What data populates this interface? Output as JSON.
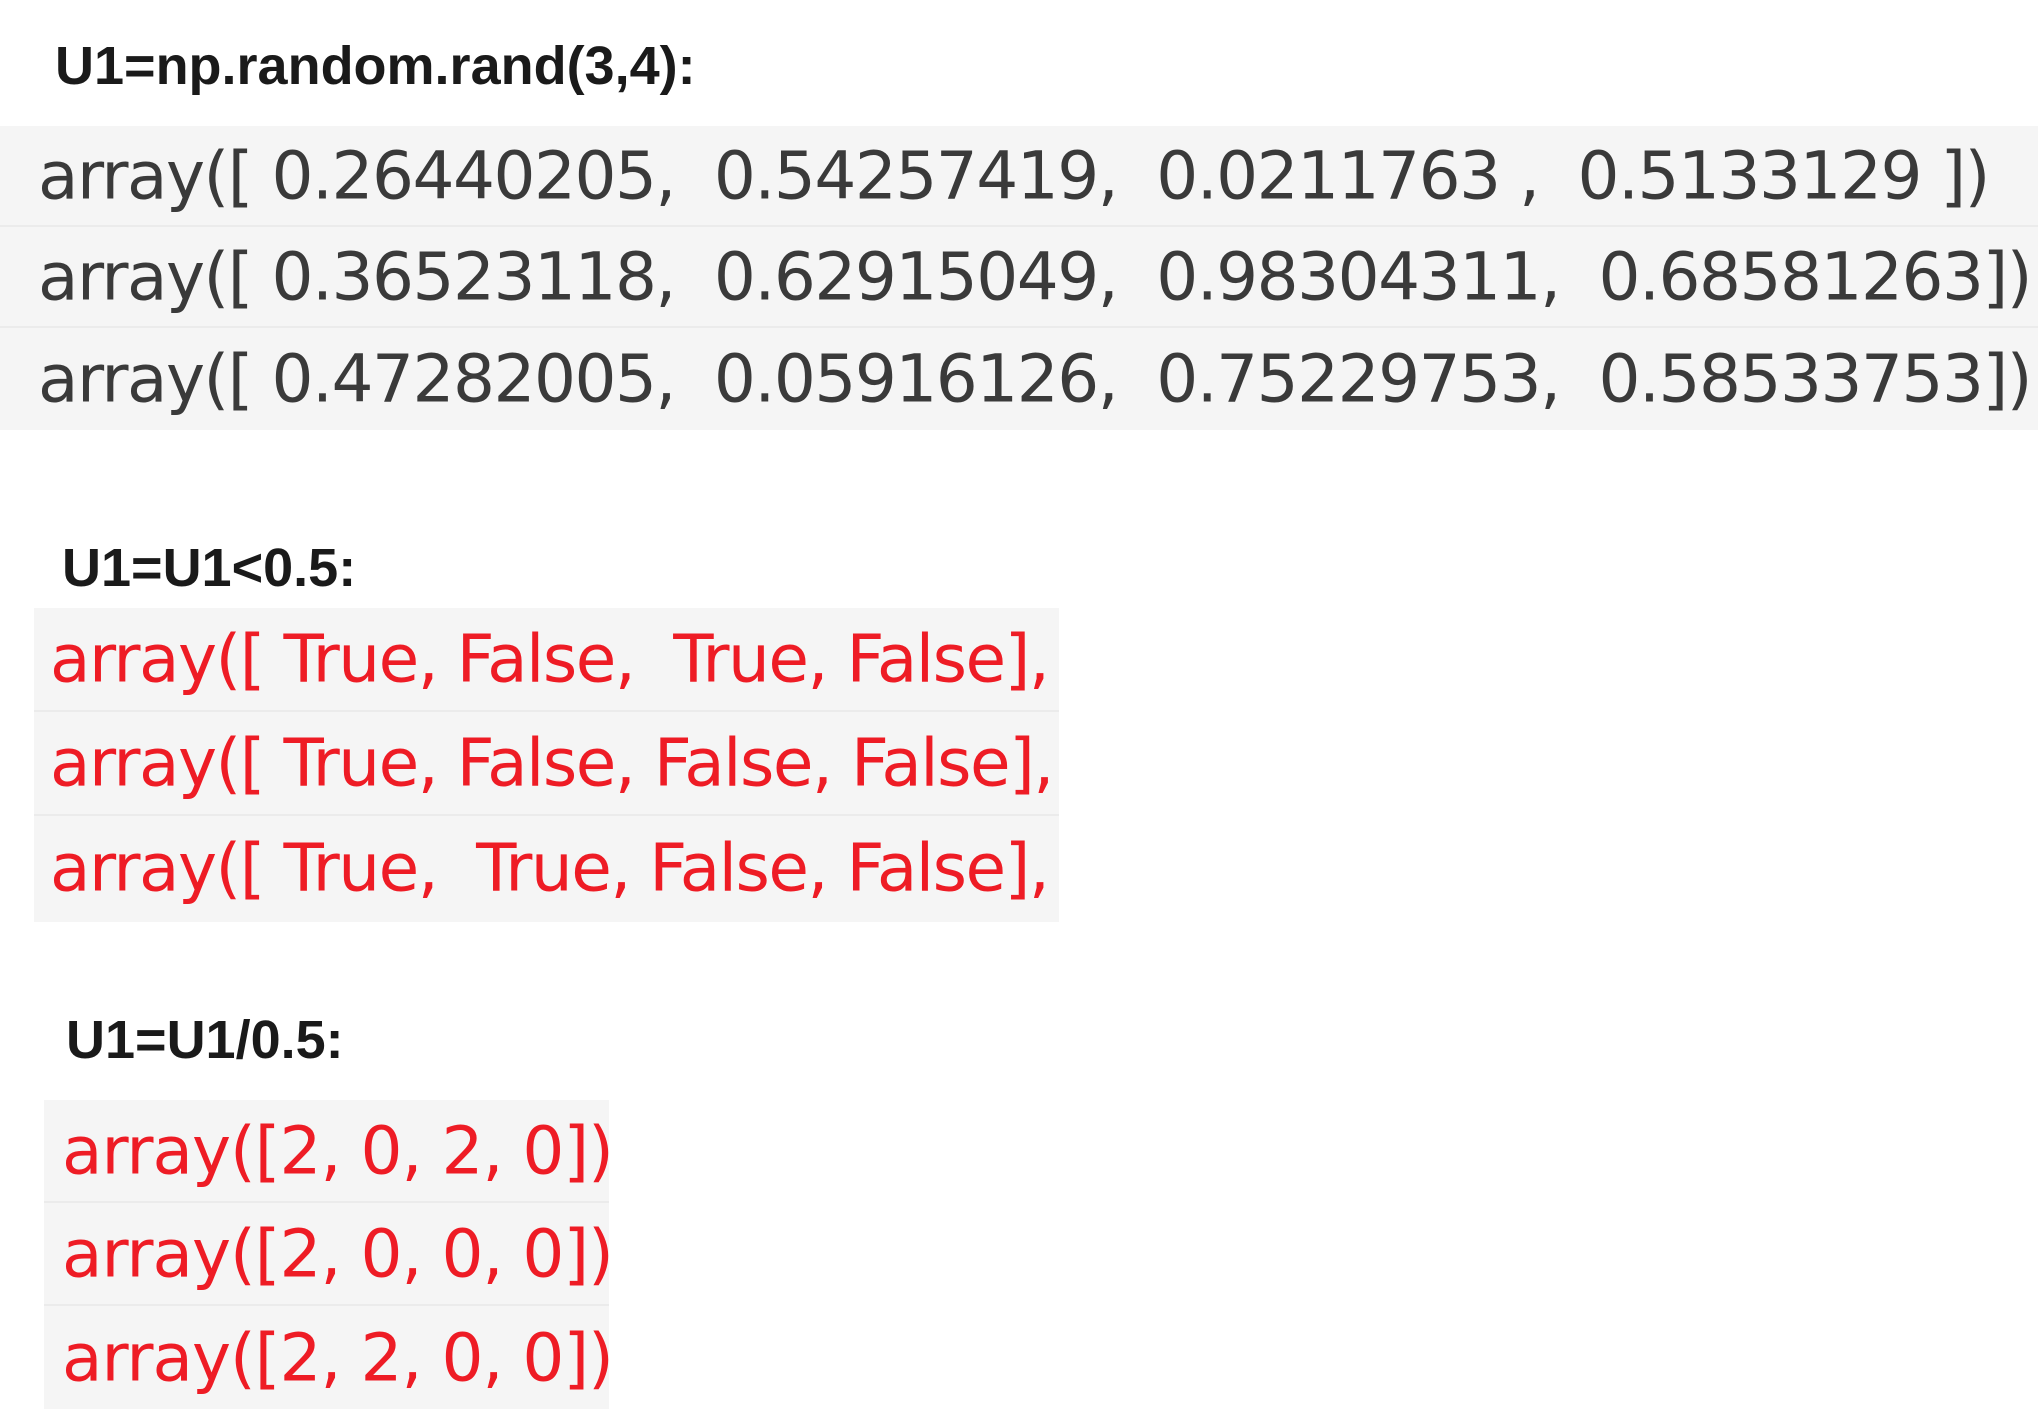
{
  "sections": [
    {
      "heading": "U1=np.random.rand(3,4):",
      "rows": [
        "array([ 0.26440205,  0.54257419,  0.0211763 ,  0.5133129 ])",
        "array([ 0.36523118,  0.62915049,  0.98304311,  0.68581263])",
        "array([ 0.47282005,  0.05916126,  0.75229753,  0.58533753])"
      ]
    },
    {
      "heading": "U1=U1<0.5:",
      "rows": [
        "array([ True, False,  True, False],",
        "array([ True, False, False, False],",
        "array([ True,  True, False, False],"
      ]
    },
    {
      "heading": "U1=U1/0.5:",
      "rows": [
        "array([2, 0, 2, 0])",
        "array([2, 0, 0, 0])",
        "array([2, 2, 0, 0])"
      ]
    }
  ],
  "colors": {
    "heading_text": "#1a1a1a",
    "output_text_default": "#3a3a3a",
    "output_text_highlight": "#ee1c25",
    "output_background": "#f5f5f5"
  }
}
